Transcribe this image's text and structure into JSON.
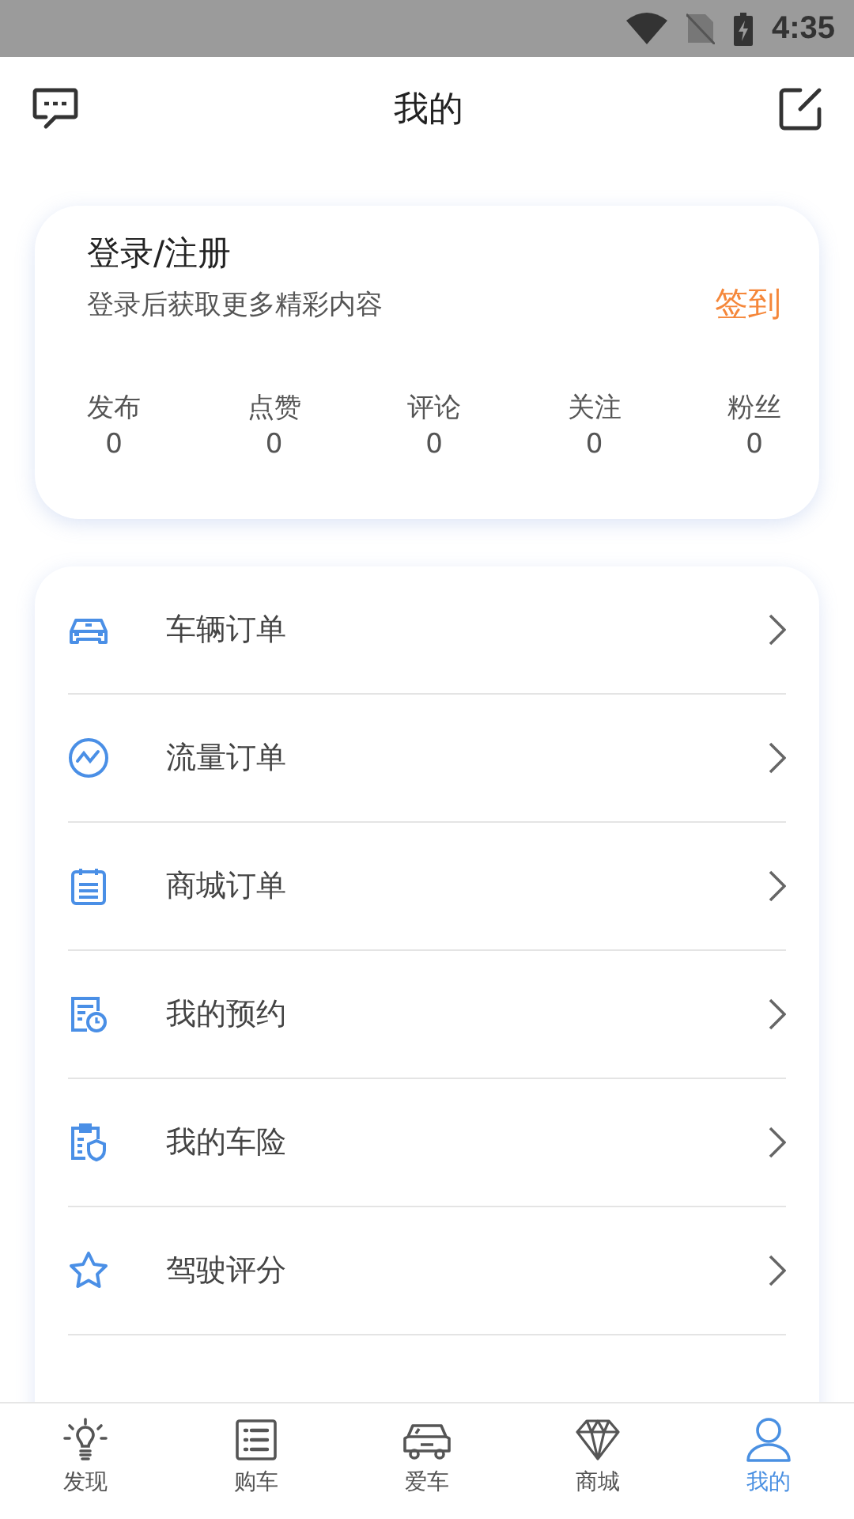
{
  "status_bar": {
    "time": "4:35"
  },
  "header": {
    "title": "我的"
  },
  "profile": {
    "title": "登录/注册",
    "subtitle": "登录后获取更多精彩内容",
    "checkin": "签到",
    "stats": [
      {
        "label": "发布",
        "value": "0"
      },
      {
        "label": "点赞",
        "value": "0"
      },
      {
        "label": "评论",
        "value": "0"
      },
      {
        "label": "关注",
        "value": "0"
      },
      {
        "label": "粉丝",
        "value": "0"
      }
    ]
  },
  "menu": [
    {
      "label": "车辆订单"
    },
    {
      "label": "流量订单"
    },
    {
      "label": "商城订单"
    },
    {
      "label": "我的预约"
    },
    {
      "label": "我的车险"
    },
    {
      "label": "驾驶评分"
    }
  ],
  "tab_bar": [
    {
      "label": "发现",
      "selected": false
    },
    {
      "label": "购车",
      "selected": false
    },
    {
      "label": "爱车",
      "selected": false
    },
    {
      "label": "商城",
      "selected": false
    },
    {
      "label": "我的",
      "selected": true
    }
  ]
}
